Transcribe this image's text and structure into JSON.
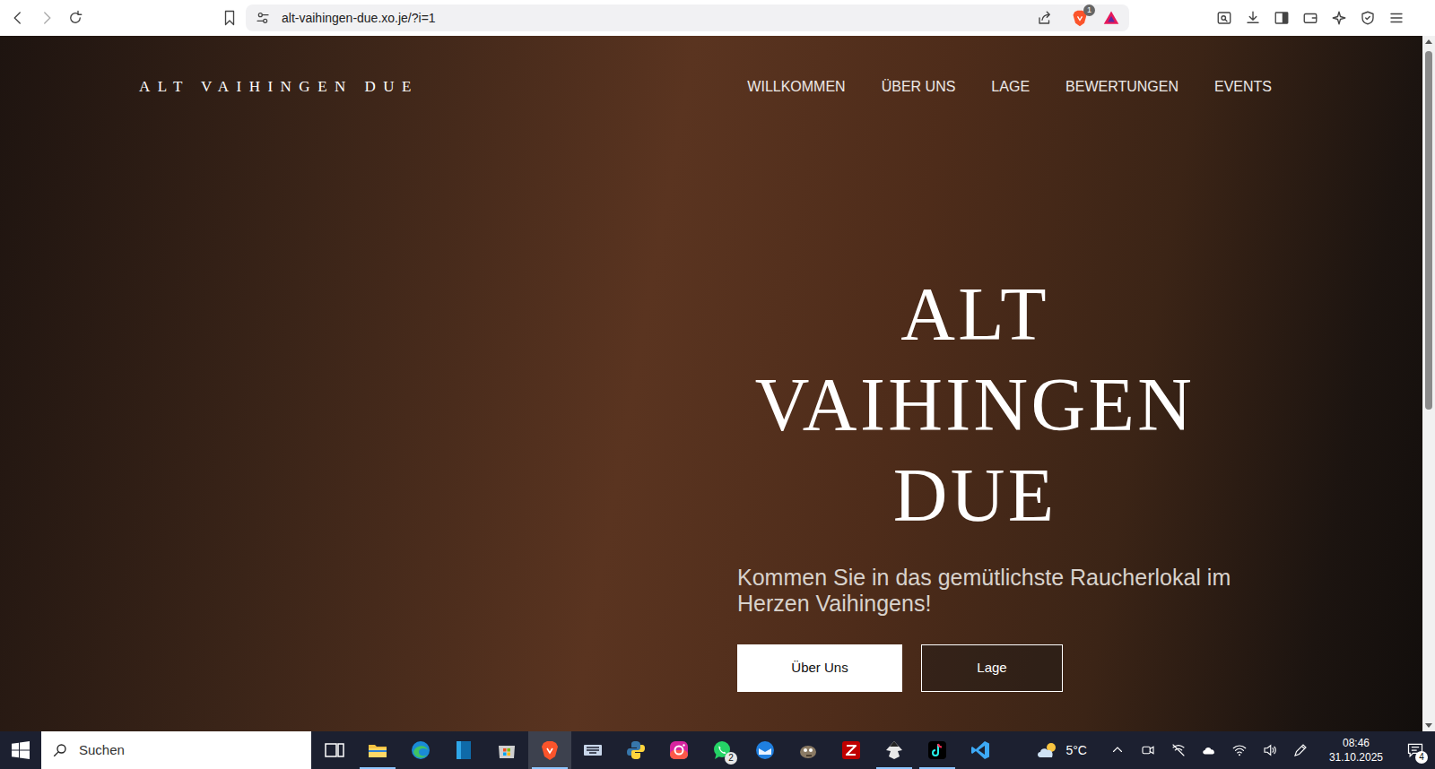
{
  "browser": {
    "url": "alt-vaihingen-due.xo.je/?i=1",
    "shields_badge": "1"
  },
  "site": {
    "logo": "ALT VAIHINGEN DUE",
    "nav": [
      {
        "label": "WILLKOMMEN"
      },
      {
        "label": "ÜBER UNS"
      },
      {
        "label": "LAGE"
      },
      {
        "label": "BEWERTUNGEN"
      },
      {
        "label": "EVENTS"
      }
    ],
    "hero": {
      "title_lines": [
        "ALT",
        "VAIHINGEN",
        "DUE"
      ],
      "subtitle": "Kommen Sie in das gemütlichste Raucherlokal im Herzen Vaihingens!",
      "buttons": [
        {
          "label": "Über Uns",
          "kind": "filled"
        },
        {
          "label": "Lage",
          "kind": "outline"
        }
      ]
    }
  },
  "taskbar": {
    "search_placeholder": "Suchen",
    "apps": [
      {
        "kind": "task-view",
        "running": false,
        "selected": false
      },
      {
        "kind": "file-explorer",
        "running": true,
        "selected": false
      },
      {
        "kind": "edge",
        "running": false,
        "selected": false
      },
      {
        "kind": "blue-app",
        "running": false,
        "selected": false
      },
      {
        "kind": "store",
        "running": false,
        "selected": false
      },
      {
        "kind": "brave",
        "running": true,
        "selected": true
      },
      {
        "kind": "keyboard",
        "running": false,
        "selected": false
      },
      {
        "kind": "python",
        "running": false,
        "selected": false
      },
      {
        "kind": "instagram",
        "running": false,
        "selected": false
      },
      {
        "kind": "whatsapp",
        "running": false,
        "selected": false,
        "badge": "2"
      },
      {
        "kind": "thunderbird",
        "running": false,
        "selected": false
      },
      {
        "kind": "gimp",
        "running": false,
        "selected": false
      },
      {
        "kind": "filezilla",
        "running": false,
        "selected": false
      },
      {
        "kind": "inkscape",
        "running": true,
        "selected": false
      },
      {
        "kind": "tiktok",
        "running": true,
        "selected": false
      },
      {
        "kind": "vscode",
        "running": false,
        "selected": false
      }
    ],
    "weather": {
      "temp": "5°C"
    },
    "clock": {
      "time": "08:46",
      "date": "31.10.2025"
    },
    "notifications": {
      "badge": "4"
    }
  }
}
